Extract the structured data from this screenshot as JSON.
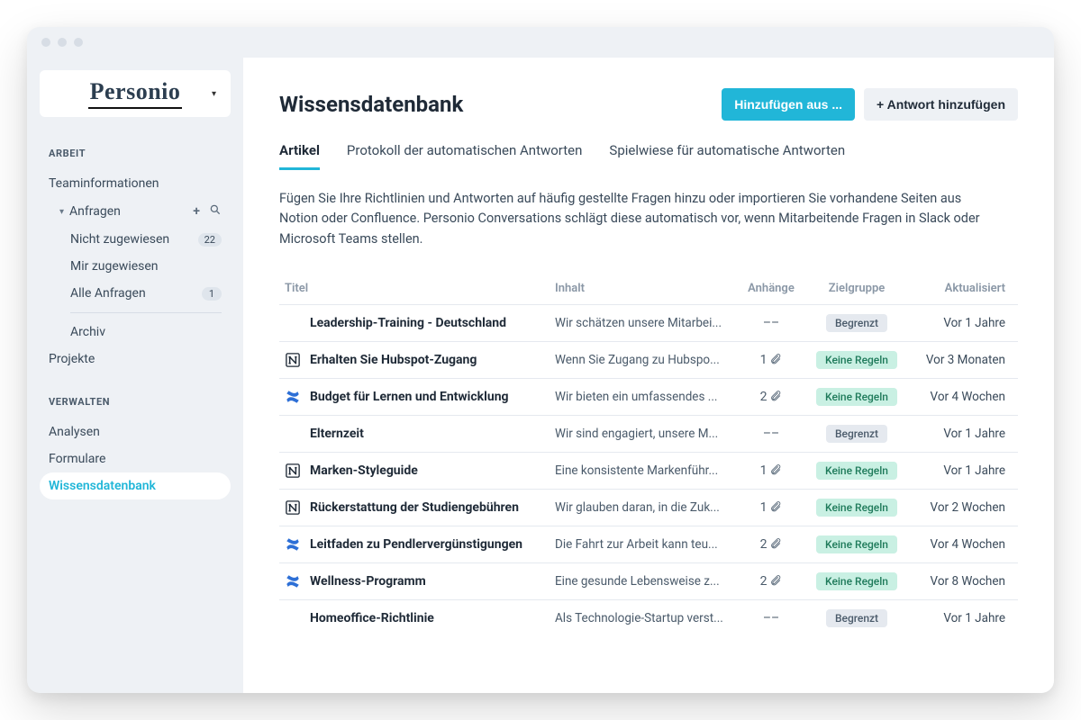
{
  "brand": "Personio",
  "sidebar": {
    "section_work": "ARBEIT",
    "section_manage": "VERWALTEN",
    "items": {
      "teaminfo": "Teaminformationen",
      "requests": "Anfragen",
      "not_assigned": "Nicht zugewiesen",
      "not_assigned_count": "22",
      "assigned_me": "Mir zugewiesen",
      "all_requests": "Alle Anfragen",
      "all_requests_count": "1",
      "archive": "Archiv",
      "projects": "Projekte",
      "analyses": "Analysen",
      "forms": "Formulare",
      "kb": "Wissensdatenbank"
    }
  },
  "header": {
    "title": "Wissensdatenbank",
    "btn_add_from": "Hinzufügen aus ...",
    "btn_add_answer": "+ Antwort hinzufügen"
  },
  "tabs": {
    "articles": "Artikel",
    "protocol": "Protokoll der automatischen Antworten",
    "playground": "Spielwiese für automatische Antworten"
  },
  "description": "Fügen Sie Ihre Richtlinien und Antworten auf häufig gestellte Fragen hinzu oder importieren Sie vorhandene Seiten aus Notion oder Confluence. Personio Conversations schlägt diese automatisch vor, wenn Mitarbeitende Fragen in Slack oder Microsoft Teams stellen.",
  "table": {
    "headers": {
      "title": "Titel",
      "content": "Inhalt",
      "attachments": "Anhänge",
      "audience": "Zielgruppe",
      "updated": "Aktualisiert"
    },
    "audience_labels": {
      "limited": "Begrenzt",
      "norules": "Keine Regeln"
    },
    "rows": [
      {
        "icon": "",
        "title": "Leadership-Training - Deutschland",
        "content": "Wir schätzen unsere Mitarbei...",
        "attachments": "––",
        "audience": "limited",
        "updated": "Vor 1 Jahre"
      },
      {
        "icon": "notion",
        "title": "Erhalten Sie Hubspot-Zugang",
        "content": "Wenn Sie Zugang zu Hubspo...",
        "attachments": "1",
        "audience": "norules",
        "updated": "Vor 3 Monaten"
      },
      {
        "icon": "confluence",
        "title": "Budget für Lernen und Entwicklung",
        "content": "Wir bieten ein umfassendes ...",
        "attachments": "2",
        "audience": "norules",
        "updated": "Vor 4 Wochen"
      },
      {
        "icon": "",
        "title": "Elternzeit",
        "content": "Wir sind engagiert, unsere M...",
        "attachments": "––",
        "audience": "limited",
        "updated": "Vor 1 Jahre"
      },
      {
        "icon": "notion",
        "title": "Marken-Styleguide",
        "content": "Eine konsistente Markenführ...",
        "attachments": "1",
        "audience": "norules",
        "updated": "Vor 1 Jahre"
      },
      {
        "icon": "notion",
        "title": "Rückerstattung der Studiengebühren",
        "content": "Wir glauben daran, in die Zuk...",
        "attachments": "1",
        "audience": "norules",
        "updated": "Vor 2 Wochen"
      },
      {
        "icon": "confluence",
        "title": "Leitfaden zu Pendlervergünstigungen",
        "content": "Die Fahrt zur Arbeit kann teu...",
        "attachments": "2",
        "audience": "norules",
        "updated": "Vor 4 Wochen"
      },
      {
        "icon": "confluence",
        "title": "Wellness-Programm",
        "content": "Eine gesunde Lebensweise z...",
        "attachments": "2",
        "audience": "norules",
        "updated": "Vor 8 Wochen"
      },
      {
        "icon": "",
        "title": "Homeoffice-Richtlinie",
        "content": "Als Technologie-Startup verst...",
        "attachments": "––",
        "audience": "limited",
        "updated": "Vor 1 Jahre"
      }
    ]
  }
}
